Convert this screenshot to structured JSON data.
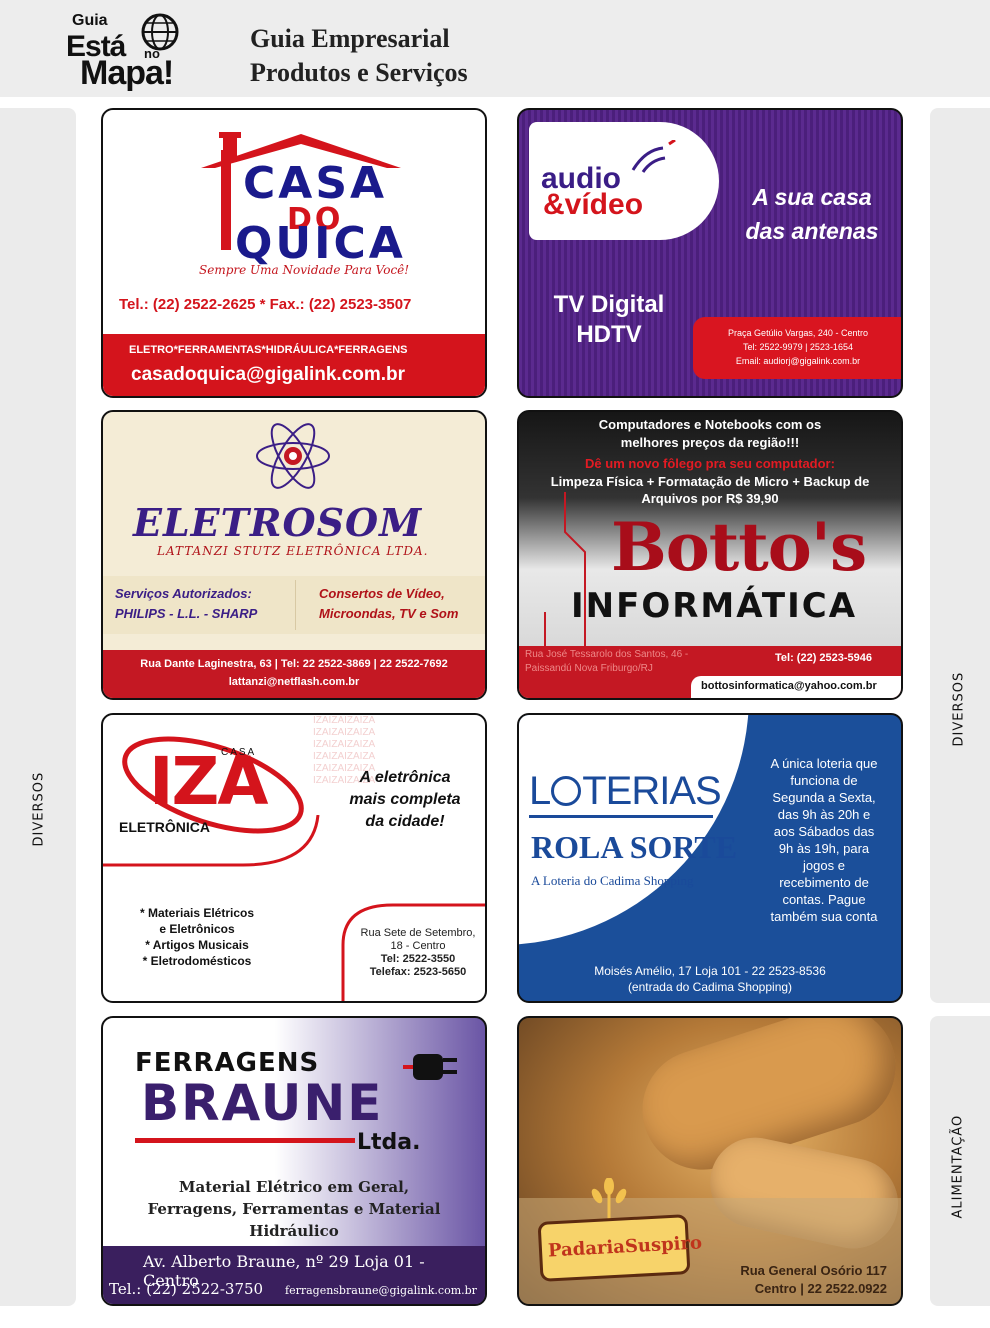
{
  "header": {
    "logo_guia": "Guia",
    "logo_esta": "Está",
    "logo_no": "no",
    "logo_mapa": "Mapa!",
    "title_line1": "Guia Empresarial",
    "title_line2": "Produtos e Serviços"
  },
  "side": {
    "left": "DIVERSOS",
    "right_top": "DIVERSOS",
    "right_bottom": "ALIMENTAÇÃO"
  },
  "quica": {
    "casa": "CASA",
    "do": "DO",
    "quica": "QUICA",
    "slogan": "Sempre Uma Novidade Para Você!",
    "tel": "Tel.: (22) 2522-2625 * Fax.: (22) 2523-3507",
    "categories": "ELETRO*FERRAMENTAS*HIDRÁULICA*FERRAGENS",
    "email": "casadoquica@gigalink.com.br"
  },
  "audio": {
    "name1": "audio",
    "name2": "&vídeo",
    "slogan1": "A sua casa",
    "slogan2": "das antenas",
    "tv1": "TV Digital",
    "tv2": "HDTV",
    "addr1": "Praça Getúlio Vargas, 240 - Centro",
    "addr2": "Tel: 2522-9979 | 2523-1654",
    "addr3": "Email: audiorj@gigalink.com.br"
  },
  "eletrosom": {
    "name": "ELETROSOM",
    "sub": "LATTANZI STUTZ ELETRÔNICA LTDA.",
    "left1": "Serviços Autorizados:",
    "left2": "PHILIPS - L.L. - SHARP",
    "right1": "Consertos de Vídeo,",
    "right2": "Microondas, TV e Som",
    "addr": "Rua Dante Laginestra, 63 | Tel: 22 2522-3869 | 22 2522-7692",
    "email": "lattanzi@netflash.com.br"
  },
  "bottos": {
    "top1": "Computadores e Notebooks com os",
    "top2": "melhores preços da região!!!",
    "red": "Dê um novo fôlego pra seu computador:",
    "clean1": "Limpeza Física + Formatação de Micro + Backup de",
    "clean2": "Arquivos por R$ 39,90",
    "name": "Botto's",
    "inf": "INFORMÁTICA",
    "addr1": "Rua José Tessarolo dos Santos, 46 -",
    "addr2": "Paissandú Nova Friburgo/RJ",
    "tel": "Tel: (22) 2523-5946",
    "email": "bottosinformatica@yahoo.com.br"
  },
  "iza": {
    "casa": "CASA",
    "name": "IZA",
    "eletronica": "ELETRÔNICA",
    "pattern": "IZAIZAIZAIZA",
    "slogan1": "A eletrônica",
    "slogan2": "mais completa",
    "slogan3": "da cidade!",
    "list1": "* Materiais Elétricos",
    "list2": "e Eletrônicos",
    "list3": "* Artigos Musicais",
    "list4": "* Eletrodomésticos",
    "addr1": "Rua Sete de Setembro,",
    "addr2": "18 - Centro",
    "tel": "Tel: 2522-3550",
    "fax": "Telefax: 2523-5650"
  },
  "loterias": {
    "name_l": "L",
    "name_rest": "TERIAS",
    "rola": "ROLA SORTE",
    "sub": "A Loteria do Cadima Shopping",
    "info": [
      "A única loteria que",
      "funciona de",
      "Segunda a Sexta,",
      "das 9h às 20h e",
      "aos Sábados das",
      "9h às 19h, para",
      "jogos e",
      "recebimento de",
      "contas. Pague",
      "também sua conta"
    ],
    "addr1": "Moisés Amélio, 17 Loja 101 - 22 2523-8536",
    "addr2": "(entrada do Cadima Shopping)"
  },
  "braune": {
    "ferragens": "FERRAGENS",
    "braune": "BRAUNE",
    "ltda": "Ltda.",
    "desc1": "Material Elétrico em Geral,",
    "desc2": "Ferragens, Ferramentas e Material Hidráulico",
    "addr": "Av. Alberto Braune, nº 29 Loja 01 - Centro",
    "tel": "Tel.: (22) 2522-3750",
    "email": "ferragensbraune@gigalink.com.br"
  },
  "padaria": {
    "name": "PadariaSuspiro",
    "addr1": "Rua General Osório 117",
    "addr2": "Centro | 22 2522.0922"
  },
  "colors": {
    "red": "#d4141c",
    "purple": "#3b1e86",
    "blue": "#1a4a9a"
  }
}
